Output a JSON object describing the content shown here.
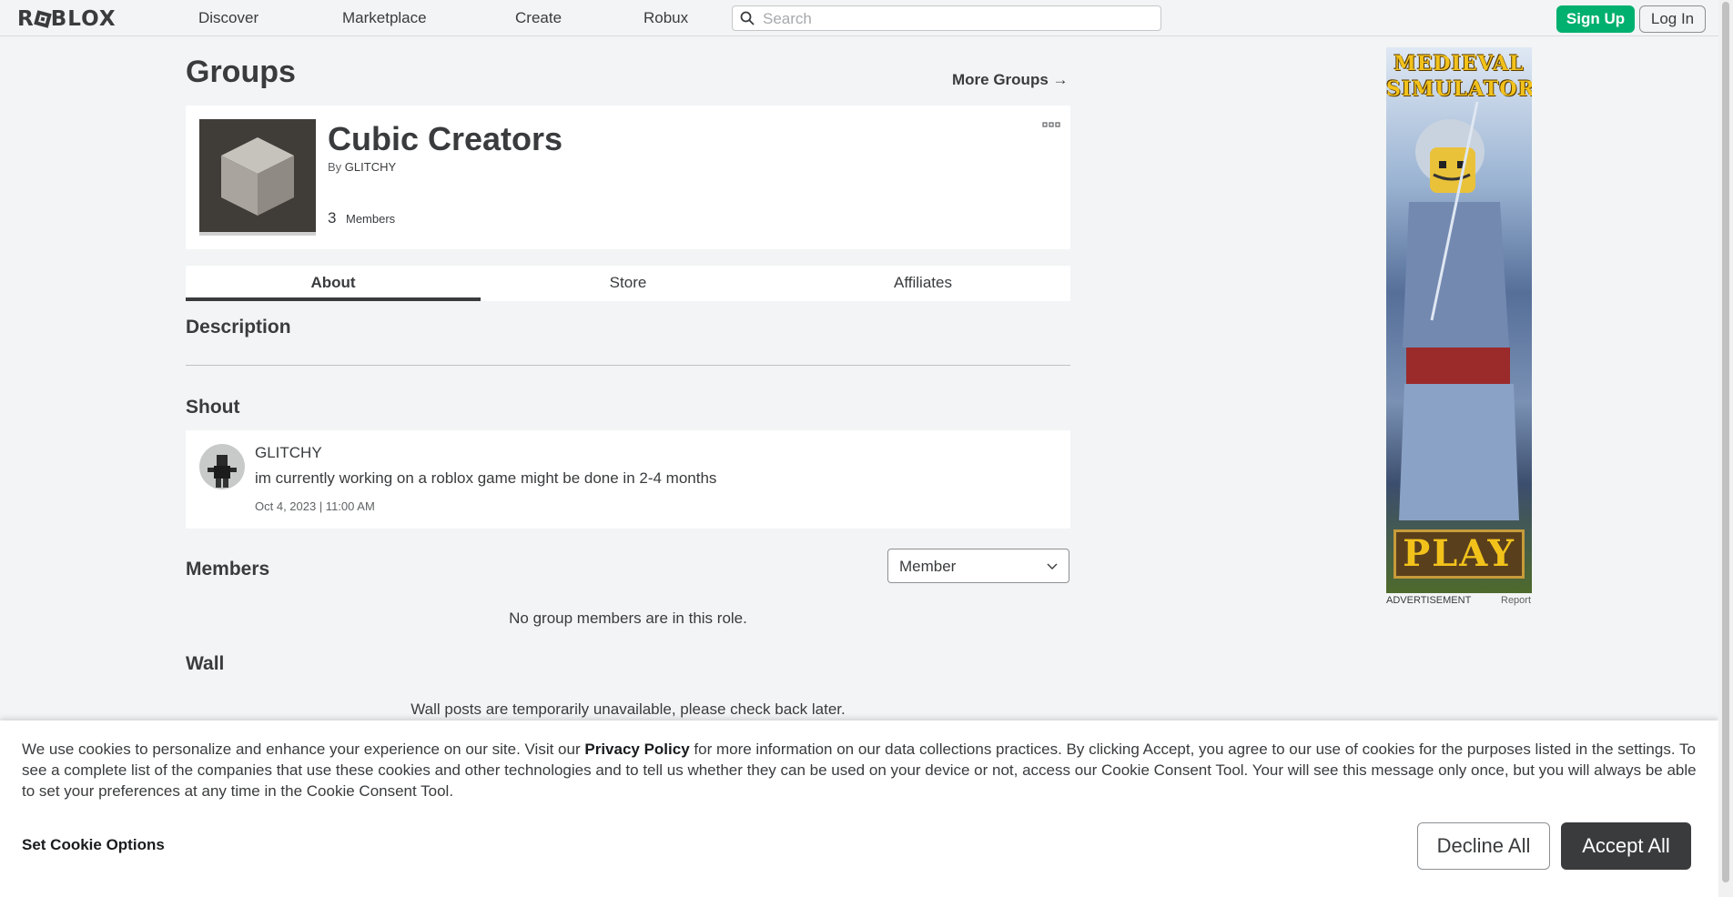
{
  "nav": {
    "logo": "ROBLOX",
    "links": [
      "Discover",
      "Marketplace",
      "Create",
      "Robux"
    ],
    "search_placeholder": "Search",
    "signup_label": "Sign Up",
    "login_label": "Log In"
  },
  "page": {
    "title": "Groups",
    "more_groups": "More Groups →"
  },
  "group": {
    "name": "Cubic Creators",
    "by_prefix": "By",
    "owner": "GLITCHY",
    "member_count": "3",
    "member_label": "Members"
  },
  "tabs": [
    {
      "label": "About",
      "active": true
    },
    {
      "label": "Store",
      "active": false
    },
    {
      "label": "Affiliates",
      "active": false
    }
  ],
  "sections": {
    "description": "Description",
    "shout": "Shout",
    "members": "Members",
    "wall": "Wall"
  },
  "shout": {
    "user": "GLITCHY",
    "text": "im currently working on a roblox game might be done in 2-4 months",
    "date": "Oct 4, 2023 | 11:00 AM"
  },
  "members": {
    "role_selected": "Member",
    "empty_msg": "No group members are in this role."
  },
  "wall": {
    "msg": "Wall posts are temporarily unavailable, please check back later."
  },
  "ad": {
    "title_line1": "MEDIEVAL",
    "title_line2": "SIMULATOR",
    "play": "PLAY",
    "label": "ADVERTISEMENT",
    "report": "Report"
  },
  "cookie": {
    "text_before": "We use cookies to personalize and enhance your experience on our site. Visit our ",
    "privacy_link": "Privacy Policy",
    "text_after": " for more information on our data collections practices. By clicking Accept, you agree to our use of cookies for the purposes listed in the settings. To see a complete list of the companies that use these cookies and other technologies and to tell us whether they can be used on your device or not, access our Cookie Consent Tool. Your will see this message only once, but you will always be able to set your preferences at any time in the Cookie Consent Tool.",
    "options_label": "Set Cookie Options",
    "decline_label": "Decline All",
    "accept_label": "Accept All"
  },
  "colors": {
    "signup": "#00b06f",
    "accept": "#393b3d",
    "background": "#f2f4f5"
  }
}
